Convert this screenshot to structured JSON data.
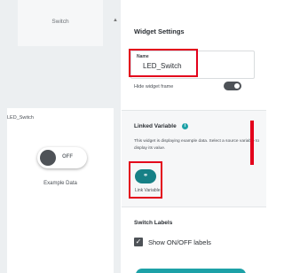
{
  "canvas": {
    "top_widget_title": "Switch",
    "widget_label": "LED_Switch",
    "switch_state_text": "OFF",
    "example_data_text": "Example Data"
  },
  "settings": {
    "heading": "Widget Settings",
    "name_caption": "Name",
    "name_value": "LED_Switch",
    "hide_frame_label": "Hide widget frame",
    "linked_variable_title": "Linked Variable",
    "linked_variable_description": "This widget is displaying example data. Select a source variable to display its value.",
    "link_button_label": "Link Variable",
    "link_button_icon": "link-icon",
    "switch_labels_title": "Switch Labels",
    "show_labels_checkbox": "Show ON/OFF labels",
    "show_labels_checked": true
  },
  "colors": {
    "teal": "#168086",
    "teal_light": "#1da1a7",
    "highlight_red": "#e3001b",
    "toggle_dark": "#4e5257"
  }
}
